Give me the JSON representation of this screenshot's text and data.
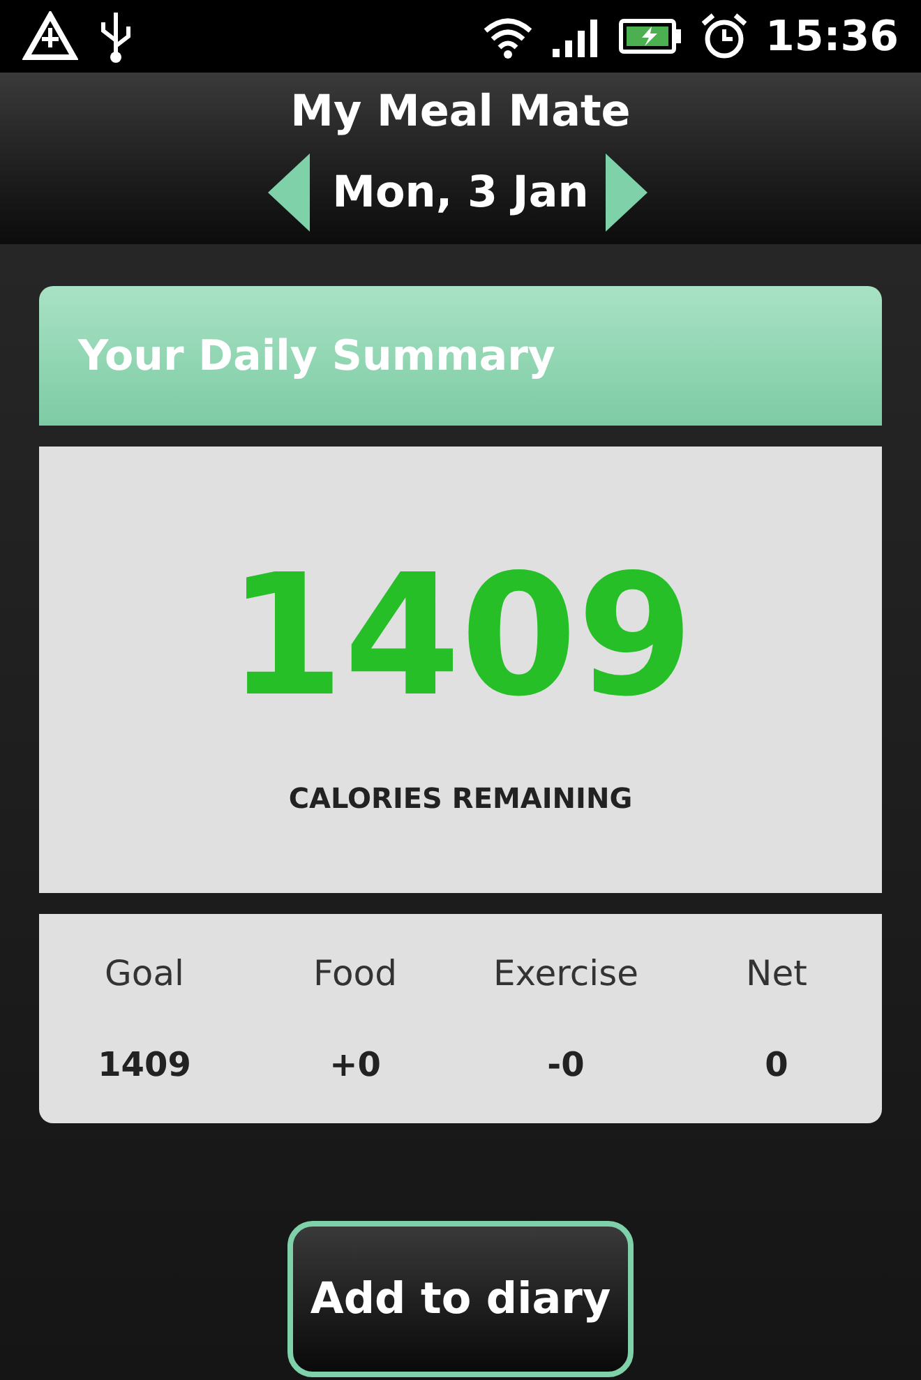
{
  "status_bar": {
    "time": "15:36"
  },
  "header": {
    "title": "My Meal Mate",
    "date": "Mon, 3 Jan"
  },
  "summary": {
    "title": "Your Daily Summary",
    "calories": "1409",
    "calories_label": "CALORIES REMAINING",
    "stats": [
      {
        "label": "Goal",
        "value": "1409"
      },
      {
        "label": "Food",
        "value": "+0"
      },
      {
        "label": "Exercise",
        "value": "-0"
      },
      {
        "label": "Net",
        "value": "0"
      }
    ]
  },
  "action_button": "Add to diary"
}
